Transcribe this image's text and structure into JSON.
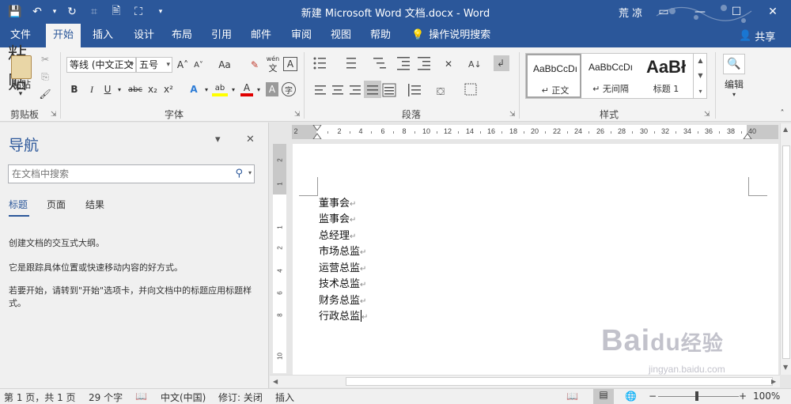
{
  "window": {
    "title": "新建 Microsoft Word 文档.docx  -  Word",
    "user": "荒 凉",
    "controls": {
      "ribbon_display": "▭",
      "minimize": "—",
      "maximize": "☐",
      "close": "✕"
    }
  },
  "qat": {
    "save": "💾",
    "undo": "↶",
    "undo_drop": "▾",
    "redo": "↻",
    "format_painter": "⌗",
    "print_preview": "🖹",
    "select": "⛶",
    "customize": "▾"
  },
  "tabs": [
    {
      "label": "文件"
    },
    {
      "label": "开始"
    },
    {
      "label": "插入"
    },
    {
      "label": "设计"
    },
    {
      "label": "布局"
    },
    {
      "label": "引用"
    },
    {
      "label": "邮件"
    },
    {
      "label": "审阅"
    },
    {
      "label": "视图"
    },
    {
      "label": "帮助"
    }
  ],
  "tell_me": {
    "icon": "💡",
    "label": "操作说明搜索"
  },
  "share": {
    "icon": "👤",
    "label": "共享"
  },
  "ribbon": {
    "clipboard": {
      "paste_label": "粘贴",
      "paste_arrow": "▾",
      "cut": "✂",
      "copy": "⎘",
      "painter": "🖌",
      "group_label": "剪贴板"
    },
    "font": {
      "font_name": "等线 (中文正文",
      "font_size": "五号",
      "grow": "A˄",
      "shrink": "A˅",
      "case": "Aa",
      "clear": "✎",
      "phonetic_top": "wén",
      "phonetic_bottom": "文",
      "border_char": "A",
      "bold": "B",
      "italic": "I",
      "underline": "U",
      "strike": "abc",
      "sub": "x₂",
      "sup": "x²",
      "effects": "A",
      "highlight": "ab",
      "color": "A",
      "shading": "A",
      "enclose": "字",
      "group_label": "字体"
    },
    "paragraph": {
      "group_label": "段落"
    },
    "styles": {
      "items": [
        {
          "sample": "AaBbCcDı",
          "name": "↵ 正文"
        },
        {
          "sample": "AaBbCcDı",
          "name": "↵ 无间隔"
        },
        {
          "sample": "AaBł",
          "name": "标题 1"
        }
      ],
      "group_label": "样式"
    },
    "editing": {
      "icon": "🔍",
      "label": "编辑",
      "arrow": "▾"
    }
  },
  "nav": {
    "title": "导航",
    "dropdown": "▾",
    "close": "✕",
    "search_placeholder": "在文档中搜索",
    "search_icon": "⚲",
    "search_arrow": "▾",
    "tabs": [
      {
        "label": "标题"
      },
      {
        "label": "页面"
      },
      {
        "label": "结果"
      }
    ],
    "paragraphs": [
      "创建文档的交互式大纲。",
      "它是跟踪具体位置或快速移动内容的好方式。",
      "若要开始，请转到\"开始\"选项卡，并向文档中的标题应用标题样式。"
    ]
  },
  "ruler": {
    "h_labels": [
      "2",
      "2",
      "4",
      "6",
      "8",
      "10",
      "12",
      "14",
      "16",
      "18",
      "20",
      "22",
      "24",
      "26",
      "28",
      "30",
      "32",
      "34",
      "36",
      "38",
      "40"
    ],
    "v_labels": [
      "2",
      "1",
      "1",
      "2",
      "4",
      "6",
      "8",
      "10"
    ]
  },
  "document": {
    "lines": [
      "董事会",
      "监事会",
      "总经理",
      "市场总监",
      "运营总监",
      "技术总监",
      "财务总监",
      "行政总监"
    ],
    "para_mark": "↵"
  },
  "statusbar": {
    "page": "第 1 页，共 1 页",
    "words": "29 个字",
    "proof_icon": "📖",
    "language": "中文(中国)",
    "track_changes": "修订: 关闭",
    "insert_mode": "插入",
    "view_read": "📖",
    "view_print": "▤",
    "view_web": "🌐",
    "zoom_minus": "−",
    "zoom_plus": "+",
    "zoom": "100%"
  },
  "watermark": {
    "brand": "Bai",
    "brand2": "du",
    "brand3": "经验",
    "url": "jingyan.baidu.com"
  }
}
